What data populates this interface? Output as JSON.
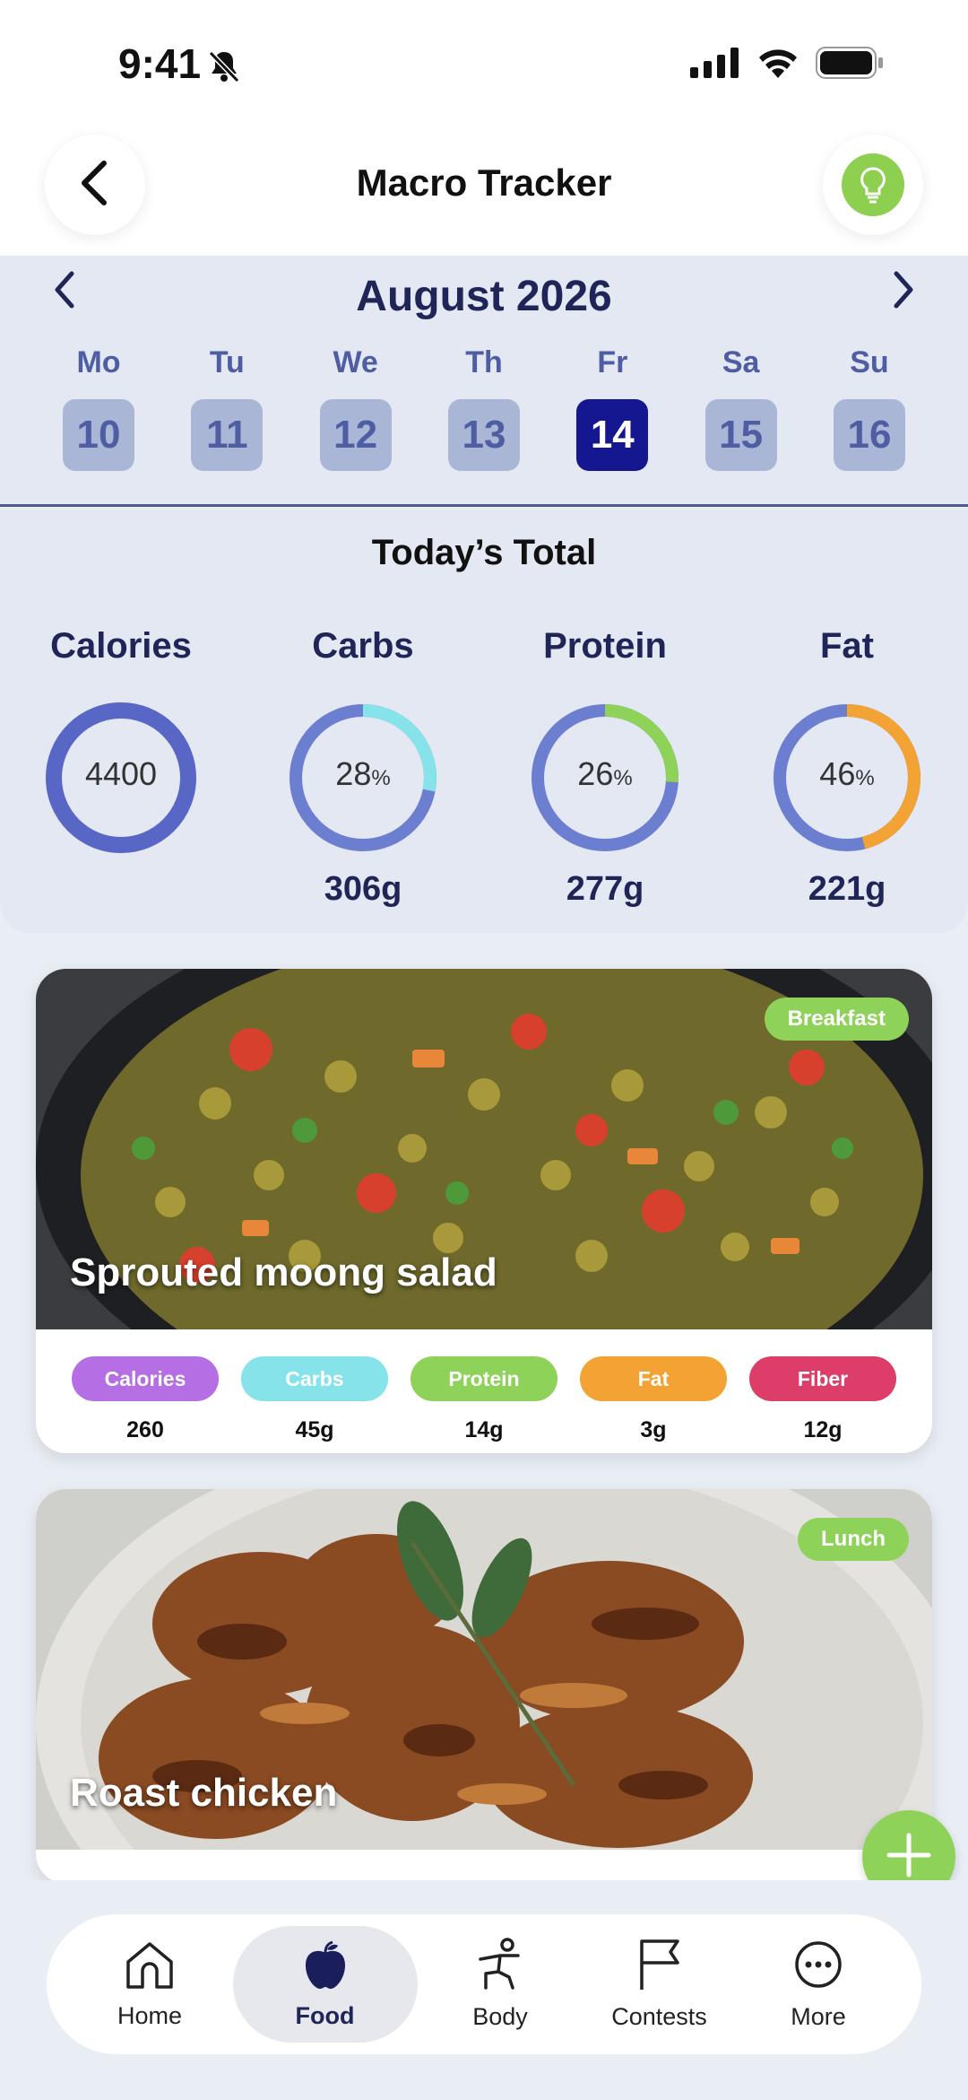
{
  "status_bar": {
    "time": "9:41"
  },
  "header": {
    "title": "Macro Tracker",
    "back_icon": "chevron-left-icon",
    "tip_icon": "lightbulb-icon"
  },
  "calendar": {
    "month": "August 2026",
    "days": [
      {
        "name": "Mo",
        "num": "10"
      },
      {
        "name": "Tu",
        "num": "11"
      },
      {
        "name": "We",
        "num": "12"
      },
      {
        "name": "Th",
        "num": "13"
      },
      {
        "name": "Fr",
        "num": "14"
      },
      {
        "name": "Sa",
        "num": "15"
      },
      {
        "name": "Su",
        "num": "16"
      }
    ],
    "selected_index": 4
  },
  "totals": {
    "title": "Today’s Total",
    "calories": {
      "label": "Calories",
      "value": "4400"
    },
    "carbs": {
      "label": "Carbs",
      "percent": "28",
      "pct_unit": "%",
      "grams": "306g"
    },
    "protein": {
      "label": "Protein",
      "percent": "26",
      "pct_unit": "%",
      "grams": "277g"
    },
    "fat": {
      "label": "Fat",
      "percent": "46",
      "pct_unit": "%",
      "grams": "221g"
    }
  },
  "colors": {
    "ring_base": "#6c7ecf",
    "calories": "#5867c6",
    "carbs": "#86e3ea",
    "protein": "#8fd259",
    "fat": "#f3a234",
    "fiber": "#dd3e69",
    "calories_pill": "#b56ee3"
  },
  "meals": [
    {
      "name": "Sprouted moong salad",
      "tag": "Breakfast",
      "nutrients": [
        {
          "label": "Calories",
          "value": "260"
        },
        {
          "label": "Carbs",
          "value": "45g"
        },
        {
          "label": "Protein",
          "value": "14g"
        },
        {
          "label": "Fat",
          "value": "3g"
        },
        {
          "label": "Fiber",
          "value": "12g"
        }
      ]
    },
    {
      "name": "Roast chicken",
      "tag": "Lunch"
    }
  ],
  "tabs": [
    {
      "label": "Home",
      "icon": "home-icon"
    },
    {
      "label": "Food",
      "icon": "apple-icon"
    },
    {
      "label": "Body",
      "icon": "body-icon"
    },
    {
      "label": "Contests",
      "icon": "flag-icon"
    },
    {
      "label": "More",
      "icon": "more-icon"
    }
  ]
}
